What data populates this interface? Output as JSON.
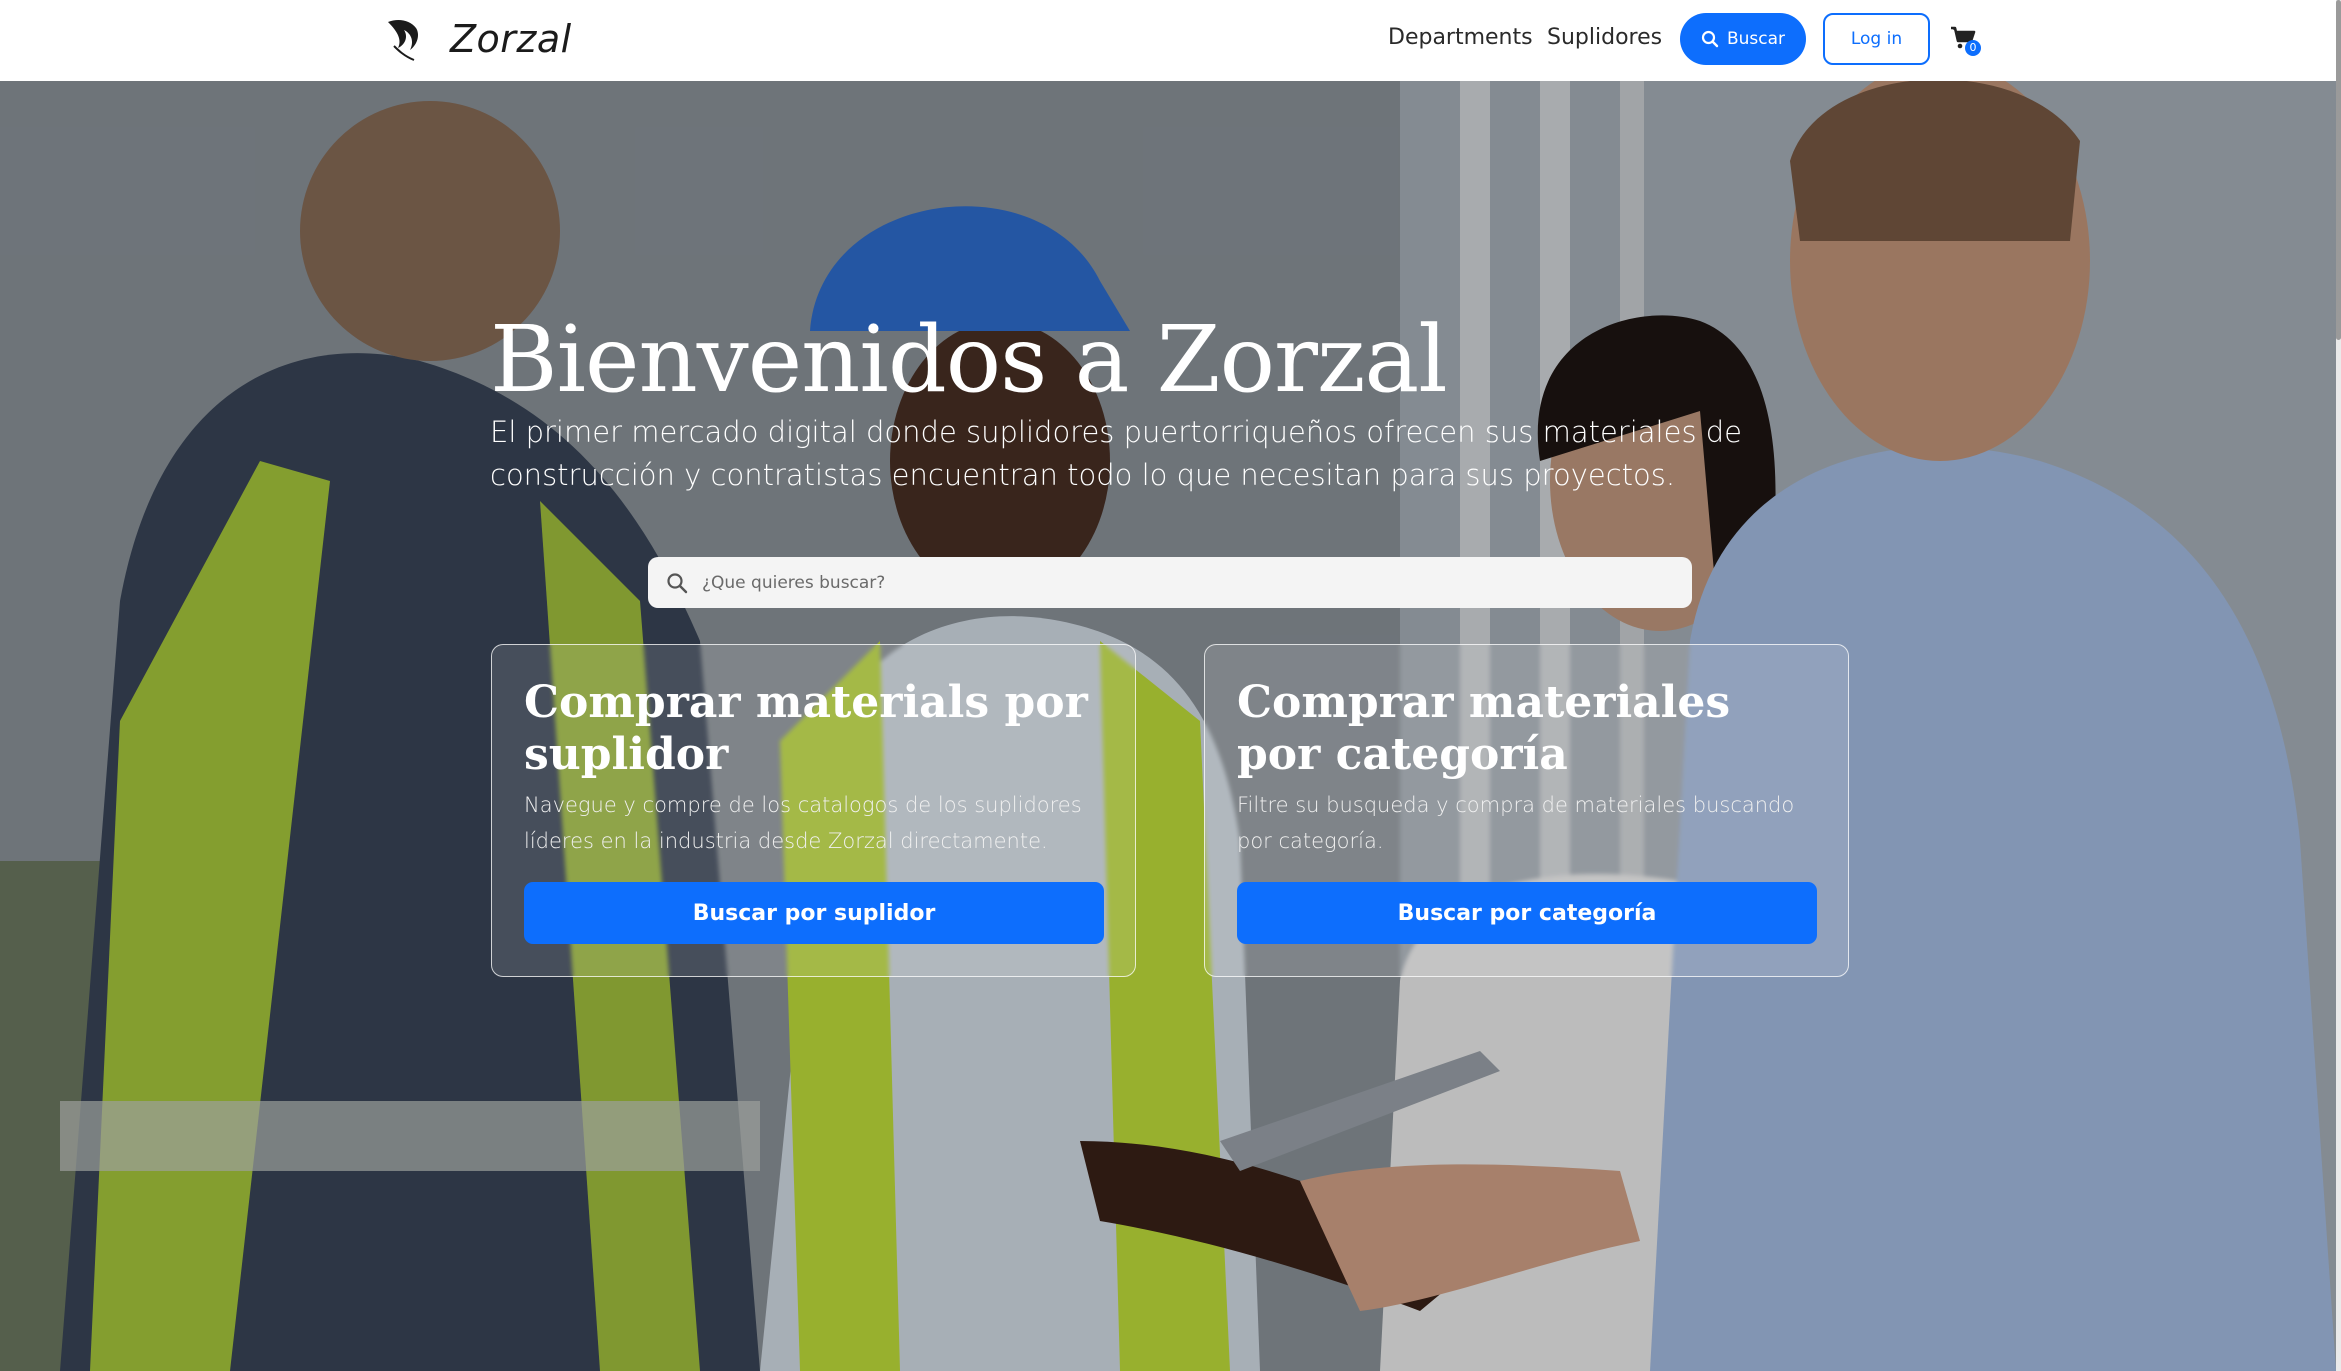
{
  "brand": {
    "name": "Zorzal",
    "logo_icon": "bird-logo-icon"
  },
  "nav": {
    "departments": "Departments",
    "suppliers": "Suplidores",
    "search_button": "Buscar",
    "login_button": "Log in",
    "cart_count": "0",
    "accent_color": "#0d6efd"
  },
  "hero": {
    "title": "Bienvenidos a Zorzal",
    "subtitle": "El primer mercado digital donde suplidores puertorriqueños ofrecen sus materiales de construcción y contratistas encuentran todo lo que necesitan para sus proyectos.",
    "search_placeholder": "¿Que quieres buscar?"
  },
  "cards": [
    {
      "title": "Comprar materials por suplidor",
      "text": "Navegue y compre de los catalogos de los suplidores líderes en la industria desde Zorzal directamente.",
      "button": "Buscar por suplidor"
    },
    {
      "title": "Comprar materiales por categoría",
      "text": "Filtre su busqueda y compra de materiales buscando por categoría.",
      "button": "Buscar por categoría"
    }
  ]
}
